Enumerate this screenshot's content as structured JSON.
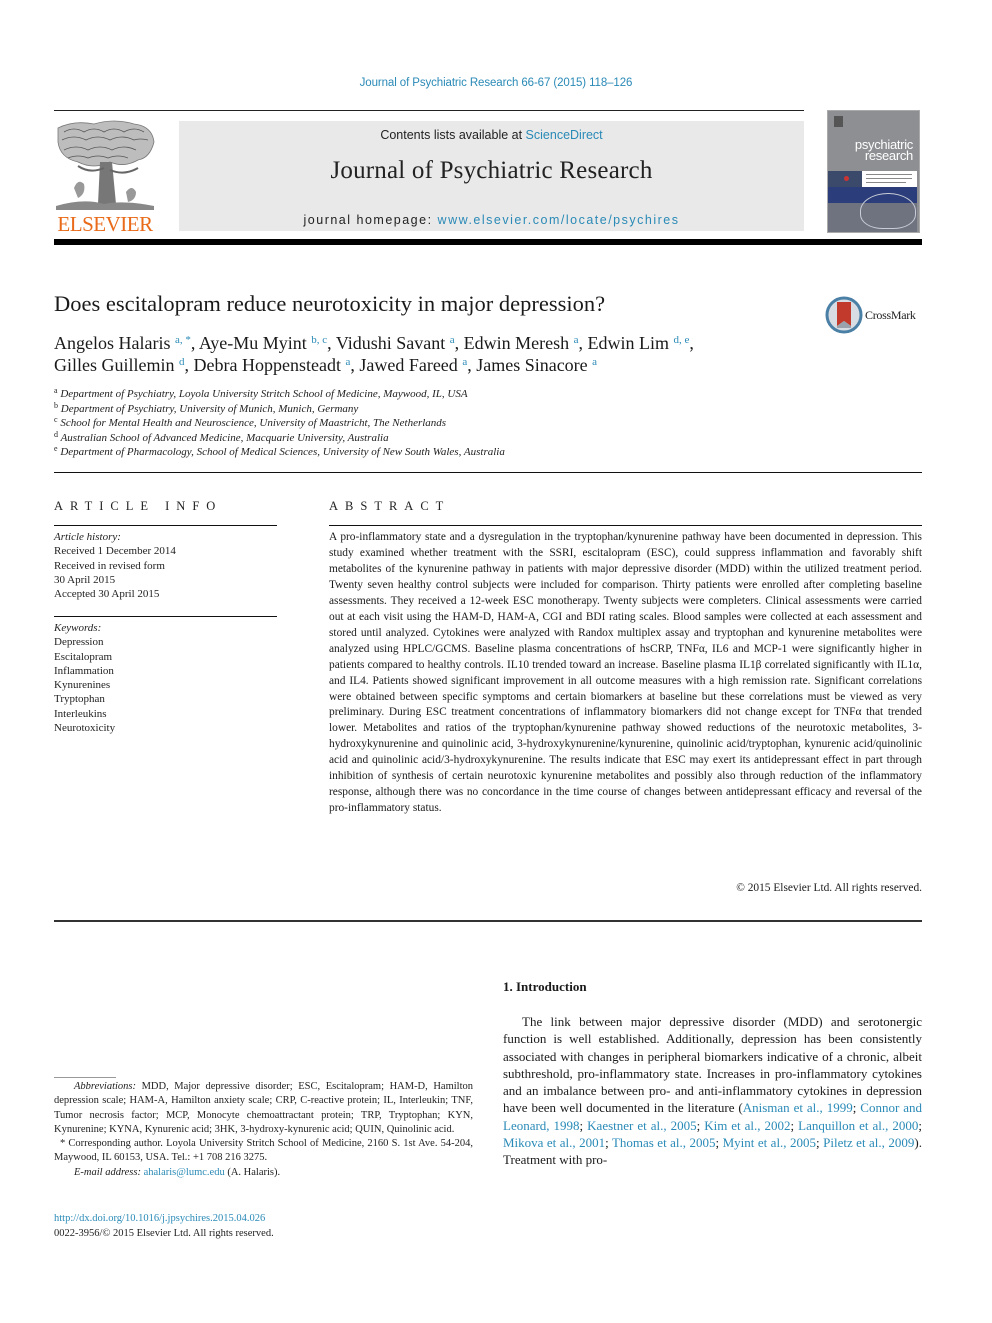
{
  "running_head": "Journal of Psychiatric Research 66-67 (2015) 118–126",
  "masthead": {
    "publisher": "ELSEVIER",
    "contents_prefix": "Contents lists available at ",
    "contents_link": "ScienceDirect",
    "journal_name": "Journal of Psychiatric Research",
    "homepage_prefix": "journal homepage: ",
    "homepage_link": "www.elsevier.com/locate/psychires",
    "cover_title_line1": "psychiatric",
    "cover_title_line2": "research"
  },
  "article": {
    "title": "Does escitalopram reduce neurotoxicity in major depression?",
    "crossmark_label": "CrossMark",
    "authors": [
      {
        "name": "Angelos Halaris",
        "sup": "a, *",
        "sep": ", "
      },
      {
        "name": "Aye-Mu Myint",
        "sup": "b, c",
        "sep": ", "
      },
      {
        "name": "Vidushi Savant",
        "sup": "a",
        "sep": ", "
      },
      {
        "name": "Edwin Meresh",
        "sup": "a",
        "sep": ", "
      },
      {
        "name": "Edwin Lim",
        "sup": "d, e",
        "sep": ","
      },
      {
        "name": "Gilles Guillemin",
        "sup": "d",
        "sep": ", "
      },
      {
        "name": "Debra Hoppensteadt",
        "sup": "a",
        "sep": ", "
      },
      {
        "name": "Jawed Fareed",
        "sup": "a",
        "sep": ", "
      },
      {
        "name": "James Sinacore",
        "sup": "a",
        "sep": ""
      }
    ],
    "affiliations": [
      {
        "key": "a",
        "text": "Department of Psychiatry, Loyola University Stritch School of Medicine, Maywood, IL, USA"
      },
      {
        "key": "b",
        "text": "Department of Psychiatry, University of Munich, Munich, Germany"
      },
      {
        "key": "c",
        "text": "School for Mental Health and Neuroscience, University of Maastricht, The Netherlands"
      },
      {
        "key": "d",
        "text": "Australian School of Advanced Medicine, Macquarie University, Australia"
      },
      {
        "key": "e",
        "text": "Department of Pharmacology, School of Medical Sciences, University of New South Wales, Australia"
      }
    ]
  },
  "article_info": {
    "heading": "ARTICLE INFO",
    "history_label": "Article history:",
    "history": [
      "Received 1 December 2014",
      "Received in revised form",
      "30 April 2015",
      "Accepted 30 April 2015"
    ],
    "keywords_label": "Keywords:",
    "keywords": [
      "Depression",
      "Escitalopram",
      "Inflammation",
      "Kynurenines",
      "Tryptophan",
      "Interleukins",
      "Neurotoxicity"
    ]
  },
  "abstract": {
    "heading": "ABSTRACT",
    "text": "A pro-inflammatory state and a dysregulation in the tryptophan/kynurenine pathway have been docu­mented in depression. This study examined whether treatment with the SSRI, escitalopram (ESC), could suppress inflammation and favorably shift metabolites of the kynurenine pathway in patients with major depressive disorder (MDD) within the utilized treatment period. Twenty seven healthy control subjects were included for comparison. Thirty patients were enrolled after completing baseline assessments. They received a 12-week ESC monotherapy. Twenty subjects were completers. Clinical assessments were carried out at each visit using the HAM-D, HAM-A, CGI and BDI rating scales. Blood samples were collected at each assessment and stored until analyzed. Cytokines were analyzed with Randox multiplex assay and tryptophan and kynurenine metabolites were analyzed using HPLC/GCMS. Baseline plasma concentrations of hsCRP, TNFα, IL6 and MCP-1 were significantly higher in patients compared to healthy controls. IL10 trended toward an increase. Baseline plasma IL1β correlated significantly with IL1α, and IL4. Patients showed significant improvement in all outcome measures with a high remission rate. Significant correlations were obtained between specific symptoms and certain biomarkers at baseline but these correlations must be viewed as very preliminary. During ESC treatment concentrations of inflammatory biomarkers did not change except for TNFα that trended lower. Metabolites and ratios of the tryptophan/kynurenine pathway showed reductions of the neurotoxic metabolites, 3-hydroxykynurenine and quinolinic acid, 3-hydroxykynurenine/kynurenine, quinolinic acid/tryptophan, kynurenic acid/quinolinic acid and quinolinic acid/3-hydroxykynurenine. The results indicate that ESC may exert its antidepressant effect in part through inhibition of synthesis of certain neurotoxic kynur­enine metabolites and possibly also through reduction of the inflammatory response, although there was no concordance in the time course of changes between antidepressant efficacy and reversal of the pro-inflammatory status.",
    "copyright": "© 2015 Elsevier Ltd. All rights reserved."
  },
  "footnotes": {
    "abbreviations_label": "Abbreviations:",
    "abbreviations_text": " MDD, Major depressive disorder; ESC, Escitalopram; HAM-D, Hamilton depression scale; HAM-A, Hamilton anxiety scale; CRP, C-reactive protein; IL, Interleukin; TNF, Tumor necrosis factor; MCP, Monocyte chemoattractant protein; TRP, Tryptophan; KYN, Kynurenine; KYNA, Kynurenic acid; 3HK, 3-hydroxy-kynurenic acid; QUIN, Quinolinic acid.",
    "corresponding": "* Corresponding author. Loyola University Stritch School of Medicine, 2160 S. 1st Ave. 54-204, Maywood, IL 60153, USA. Tel.: +1 708 216 3275.",
    "email_label": "E-mail address:",
    "email": "ahalaris@lumc.edu",
    "email_suffix": " (A. Halaris).",
    "doi": "http://dx.doi.org/10.1016/j.jpsychires.2015.04.026",
    "issn_line": "0022-3956/© 2015 Elsevier Ltd. All rights reserved."
  },
  "introduction": {
    "heading": "1.  Introduction",
    "text_before": "The link between major depressive disorder (MDD) and sero­tonergic function is well established. Additionally, depression has been consistently associated with changes in peripheral biomarkers indicative of a chronic, albeit subthreshold, pro-inflammatory state. Increases in pro-inflammatory cytokines and an imbalance be­tween pro- and anti-inflammatory cytokines in depression have been well documented in the literature (",
    "citations": [
      "Anisman et al., 1999",
      "Connor and Leonard, 1998",
      "Kaestner et al., 2005",
      "Kim et al., 2002",
      "Lanquillon et al., 2000",
      "Mikova et al., 2001",
      "Thomas et al., 2005",
      "Myint et al., 2005",
      "Piletz et al., 2009"
    ],
    "text_after": "). Treatment with pro-"
  },
  "colors": {
    "link": "#2a8ab7",
    "elsevier_orange": "#e96a18",
    "masthead_bg": "#e9e9e9"
  }
}
